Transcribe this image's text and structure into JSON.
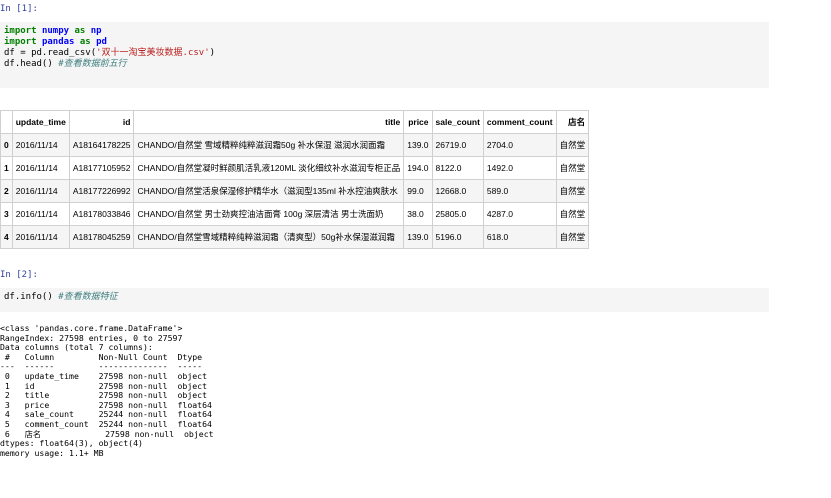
{
  "cells": [
    {
      "prompt": "In [1]:",
      "code_lines": [
        [
          {
            "t": "import",
            "c": "kw"
          },
          {
            "t": " ",
            "c": "pl"
          },
          {
            "t": "numpy",
            "c": "nm"
          },
          {
            "t": " ",
            "c": "pl"
          },
          {
            "t": "as",
            "c": "kw"
          },
          {
            "t": " ",
            "c": "pl"
          },
          {
            "t": "np",
            "c": "nm"
          }
        ],
        [
          {
            "t": "import",
            "c": "kw"
          },
          {
            "t": " ",
            "c": "pl"
          },
          {
            "t": "pandas",
            "c": "nm"
          },
          {
            "t": " ",
            "c": "pl"
          },
          {
            "t": "as",
            "c": "kw"
          },
          {
            "t": " ",
            "c": "pl"
          },
          {
            "t": "pd",
            "c": "nm"
          }
        ],
        [
          {
            "t": "df = pd.read_csv(",
            "c": "pl"
          },
          {
            "t": "'双十一淘宝美妆数据.csv'",
            "c": "str"
          },
          {
            "t": ")",
            "c": "pl"
          }
        ],
        [
          {
            "t": "df.head() ",
            "c": "pl"
          },
          {
            "t": "#查看数据前五行",
            "c": "cm"
          }
        ]
      ]
    },
    {
      "prompt": "In [2]:",
      "code_lines": [
        [
          {
            "t": "df.info() ",
            "c": "pl"
          },
          {
            "t": "#查看数据特征",
            "c": "cm"
          }
        ]
      ]
    }
  ],
  "dataframe": {
    "columns": [
      "",
      "update_time",
      "id",
      "title",
      "price",
      "sale_count",
      "comment_count",
      "店名"
    ],
    "rows": [
      [
        "0",
        "2016/11/14",
        "A18164178225",
        "CHANDO/自然堂 雪域精粹纯粹滋润霜50g 补水保湿 滋润水润面霜",
        "139.0",
        "26719.0",
        "2704.0",
        "自然堂"
      ],
      [
        "1",
        "2016/11/14",
        "A18177105952",
        "CHANDO/自然堂凝时鲜颜肌活乳液120ML 淡化细纹补水滋润专柜正品",
        "194.0",
        "8122.0",
        "1492.0",
        "自然堂"
      ],
      [
        "2",
        "2016/11/14",
        "A18177226992",
        "CHANDO/自然堂活泉保湿修护精华水（滋润型135ml 补水控油爽肤水",
        "99.0",
        "12668.0",
        "589.0",
        "自然堂"
      ],
      [
        "3",
        "2016/11/14",
        "A18178033846",
        "CHANDO/自然堂 男士劲爽控油洁面膏 100g 深层清洁 男士洗面奶",
        "38.0",
        "25805.0",
        "4287.0",
        "自然堂"
      ],
      [
        "4",
        "2016/11/14",
        "A18178045259",
        "CHANDO/自然堂雪域精粹纯粹滋润霜（清爽型）50g补水保湿滋润霜",
        "139.0",
        "5196.0",
        "618.0",
        "自然堂"
      ]
    ]
  },
  "info_output": [
    "<class 'pandas.core.frame.DataFrame'>",
    "RangeIndex: 27598 entries, 0 to 27597",
    "Data columns (total 7 columns):",
    " #   Column         Non-Null Count  Dtype  ",
    "---  ------         --------------  -----  ",
    " 0   update_time    27598 non-null  object ",
    " 1   id             27598 non-null  object ",
    " 2   title          27598 non-null  object ",
    " 3   price          27598 non-null  float64",
    " 4   sale_count     25244 non-null  float64",
    " 5   comment_count  25244 non-null  float64",
    " 6   店名             27598 non-null  object ",
    "dtypes: float64(3), object(4)",
    "memory usage: 1.1+ MB"
  ]
}
